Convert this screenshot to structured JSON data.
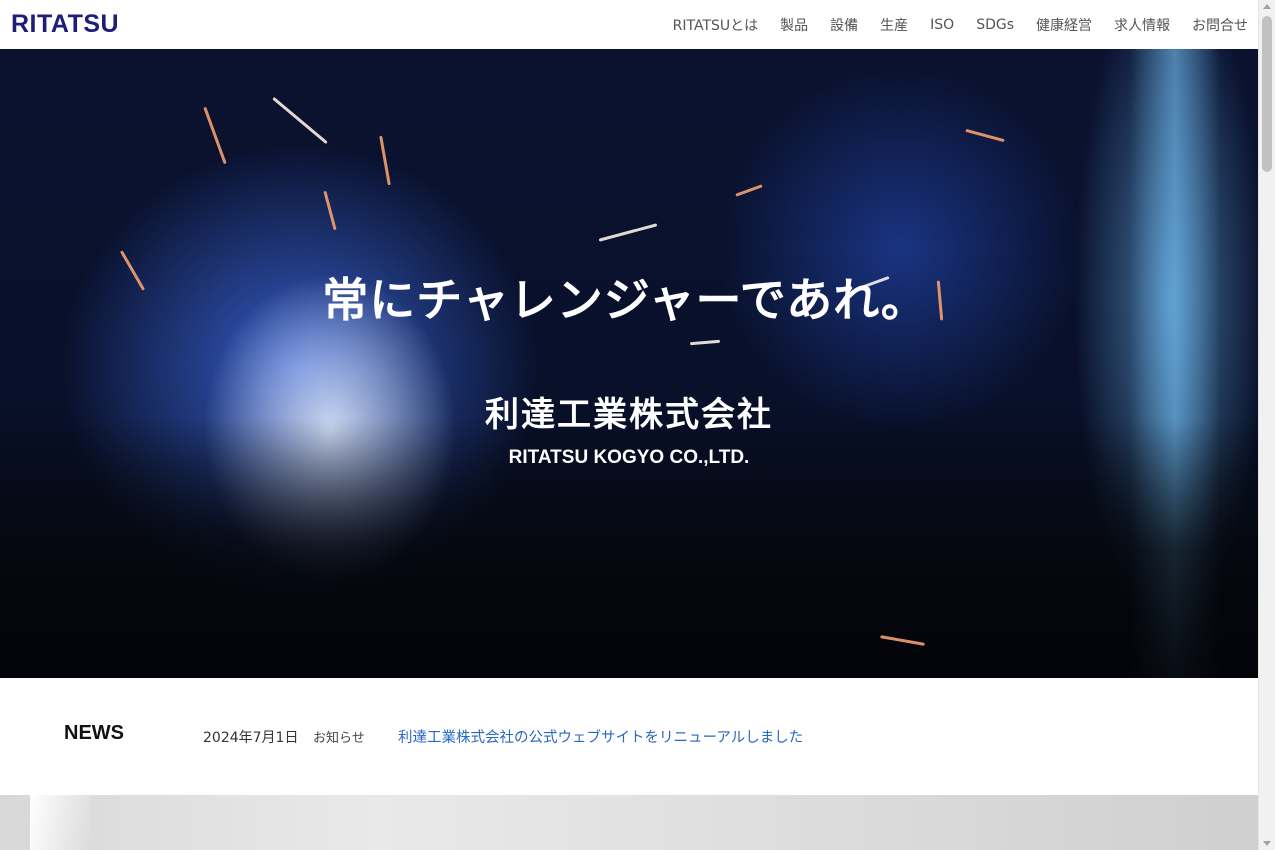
{
  "header": {
    "logo": "RITATSU",
    "nav": [
      {
        "label": "RITATSUとは"
      },
      {
        "label": "製品"
      },
      {
        "label": "設備"
      },
      {
        "label": "生産"
      },
      {
        "label": "ISO"
      },
      {
        "label": "SDGs"
      },
      {
        "label": "健康経営"
      },
      {
        "label": "求人情報"
      },
      {
        "label": "お問合せ"
      }
    ]
  },
  "hero": {
    "tagline": "常にチャレンジャーであれ。",
    "company_ja": "利達工業株式会社",
    "company_en": "RITATSU KOGYO CO.,LTD."
  },
  "news": {
    "heading": "NEWS",
    "items": [
      {
        "date": "2024年7月1日",
        "category": "お知らせ",
        "title": "利達工業株式会社の公式ウェブサイトをリニューアルしました"
      }
    ]
  },
  "colors": {
    "logo": "#1e1d7a",
    "link": "#2a67c4"
  },
  "icons": {
    "scroll_up": "arrow-up-icon",
    "scroll_down": "arrow-down-icon"
  }
}
